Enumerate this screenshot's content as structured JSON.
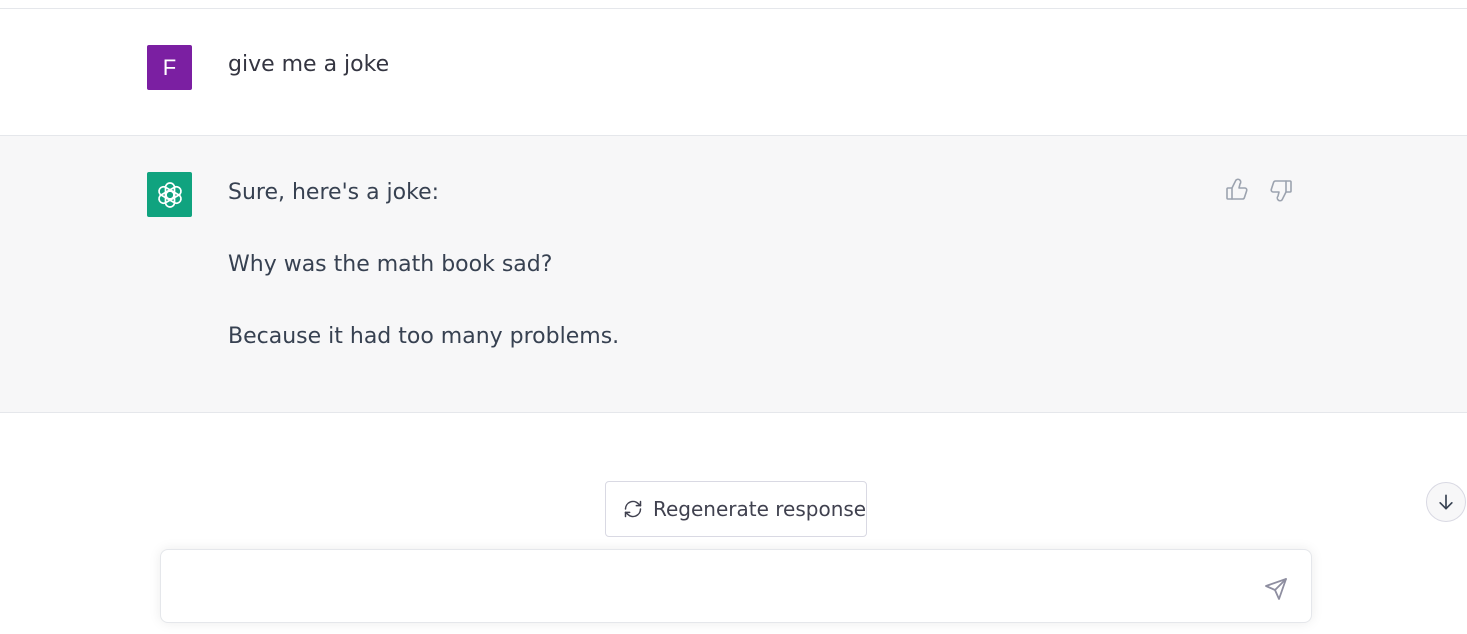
{
  "conversation": {
    "user": {
      "avatar_letter": "F",
      "avatar_color": "#7b1fa2",
      "message": "give me a joke"
    },
    "assistant": {
      "avatar_icon": "openai-logo-icon",
      "avatar_color": "#10a37f",
      "paragraphs": [
        "Sure, here's a joke:",
        "Why was the math book sad?",
        "Because it had too many problems."
      ],
      "feedback": {
        "thumbs_up_icon": "thumbs-up-icon",
        "thumbs_down_icon": "thumbs-down-icon"
      }
    }
  },
  "controls": {
    "regenerate_label": "Regenerate response",
    "regenerate_icon": "refresh-icon",
    "scroll_down_icon": "arrow-down-icon"
  },
  "composer": {
    "value": "",
    "placeholder": "",
    "send_icon": "send-icon"
  }
}
